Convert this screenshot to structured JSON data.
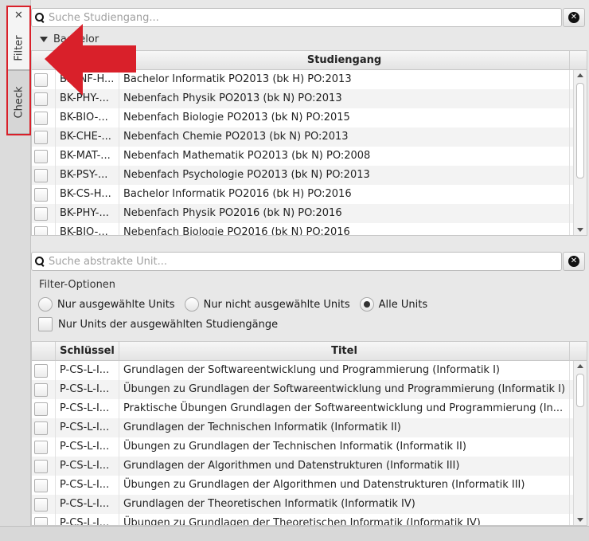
{
  "tabs": [
    {
      "label": "Filter",
      "active": true
    },
    {
      "label": "Check",
      "active": false
    }
  ],
  "icons": {
    "close_tab": "close-icon",
    "search": "search-icon",
    "clear": "clear-icon"
  },
  "colors": {
    "annotation_red": "#d9202a"
  },
  "study_search": {
    "placeholder": "Suche Studiengang...",
    "value": ""
  },
  "group": {
    "label": "Bachelor",
    "expanded": true
  },
  "study_table": {
    "columns": [
      "",
      "",
      "Studiengang"
    ],
    "rows": [
      {
        "key": "BK-INF-H...",
        "name": "Bachelor Informatik PO2013 (bk H) PO:2013"
      },
      {
        "key": "BK-PHY-...",
        "name": "Nebenfach Physik PO2013 (bk N) PO:2013"
      },
      {
        "key": "BK-BIO-...",
        "name": "Nebenfach Biologie PO2013 (bk N) PO:2015"
      },
      {
        "key": "BK-CHE-...",
        "name": "Nebenfach Chemie PO2013 (bk N) PO:2013"
      },
      {
        "key": "BK-MAT-...",
        "name": "Nebenfach Mathematik PO2013 (bk N) PO:2008"
      },
      {
        "key": "BK-PSY-...",
        "name": "Nebenfach Psychologie PO2013 (bk N) PO:2013"
      },
      {
        "key": "BK-CS-H...",
        "name": "Bachelor Informatik PO2016 (bk H) PO:2016"
      },
      {
        "key": "BK-PHY-...",
        "name": "Nebenfach Physik PO2016 (bk N) PO:2016"
      },
      {
        "key": "BK-BIO-...",
        "name": "Nebenfach Biologie PO2016 (bk N) PO:2016"
      }
    ]
  },
  "unit_search": {
    "placeholder": "Suche abstrakte Unit...",
    "value": ""
  },
  "filter_options": {
    "title": "Filter-Optionen",
    "radios": [
      {
        "label": "Nur ausgewählte Units",
        "selected": false
      },
      {
        "label": "Nur nicht ausgewählte Units",
        "selected": false
      },
      {
        "label": "Alle Units",
        "selected": true
      }
    ],
    "checkbox_label": "Nur Units der ausgewählten Studiengänge"
  },
  "unit_table": {
    "columns": [
      "",
      "Schlüssel",
      "Titel"
    ],
    "rows": [
      {
        "key": "P-CS-L-I...",
        "title": "Grundlagen der Softwareentwicklung und Programmierung (Informatik I)"
      },
      {
        "key": "P-CS-L-I...",
        "title": "Übungen zu Grundlagen der Softwareentwicklung und Programmierung (Informatik I)"
      },
      {
        "key": "P-CS-L-I...",
        "title": "Praktische Übungen Grundlagen der Softwareentwicklung und Programmierung (In..."
      },
      {
        "key": "P-CS-L-I...",
        "title": "Grundlagen der Technischen Informatik (Informatik II)"
      },
      {
        "key": "P-CS-L-I...",
        "title": "Übungen zu Grundlagen der Technischen Informatik (Informatik II)"
      },
      {
        "key": "P-CS-L-I...",
        "title": "Grundlagen der Algorithmen und Datenstrukturen (Informatik III)"
      },
      {
        "key": "P-CS-L-I...",
        "title": "Übungen zu Grundlagen der Algorithmen und Datenstrukturen (Informatik III)"
      },
      {
        "key": "P-CS-L-I...",
        "title": "Grundlagen der Theoretischen Informatik (Informatik IV)"
      },
      {
        "key": "P-CS-L-I...",
        "title": "Übungen zu Grundlagen der Theoretischen Informatik (Informatik IV)"
      }
    ]
  }
}
